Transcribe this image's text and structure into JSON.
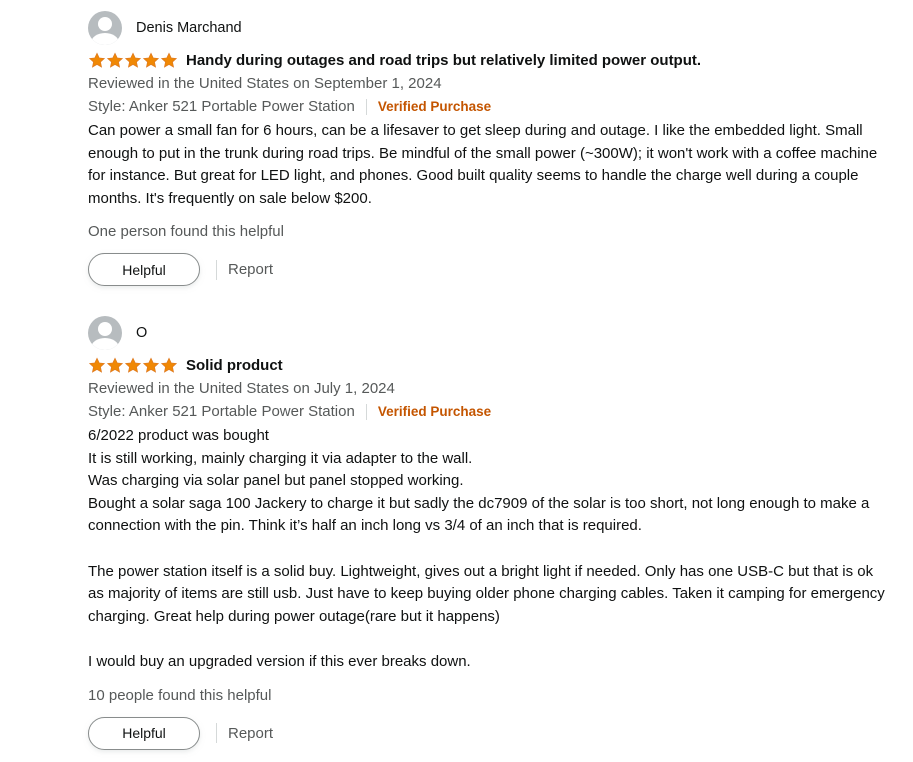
{
  "reviews": [
    {
      "reviewer": "Denis Marchand",
      "rating": 5,
      "title": "Handy during outages and road trips but relatively limited power output.",
      "reviewed_in": "Reviewed in the United States on September 1, 2024",
      "style": "Style: Anker 521 Portable Power Station",
      "verified": "Verified Purchase",
      "body": [
        "Can power a small fan for 6 hours, can be a lifesaver to get sleep during and outage. I like the embedded light. Small enough to put in the trunk during road trips. Be mindful of the small power (~300W); it won't work with a coffee machine for instance. But great for LED light, and phones. Good built quality seems to handle the charge well during a couple months. It's frequently on sale below $200."
      ],
      "helpful_count": "One person found this helpful",
      "helpful_label": "Helpful",
      "report_label": "Report"
    },
    {
      "reviewer": "O",
      "rating": 5,
      "title": "Solid product",
      "reviewed_in": "Reviewed in the United States on July 1, 2024",
      "style": "Style: Anker 521 Portable Power Station",
      "verified": "Verified Purchase",
      "body": [
        "6/2022 product was bought",
        "It is still working, mainly charging it via adapter to the wall.",
        "Was charging via solar panel but panel stopped working.",
        "Bought a solar saga 100 Jackery to charge it but sadly the dc7909 of the solar is too short, not long enough to make a connection with the pin. Think it’s half an inch long vs 3/4 of an inch that is required.",
        "",
        "The power station itself is a solid buy. Lightweight, gives out a bright light if needed. Only has one USB-C but that is ok as majority of items are still usb. Just have to keep buying older phone charging cables. Taken it camping for emergency charging. Great help during power outage(rare but it happens)",
        "",
        "I would buy an upgraded version if this ever breaks down."
      ],
      "helpful_count": "10 people found this helpful",
      "helpful_label": "Helpful",
      "report_label": "Report"
    }
  ],
  "colors": {
    "star": "#f08804",
    "verified": "#c45500",
    "meta": "#565959",
    "text": "#0f1111"
  },
  "icons": {
    "avatar": "default-user-avatar-icon",
    "star": "filled-star-icon"
  }
}
